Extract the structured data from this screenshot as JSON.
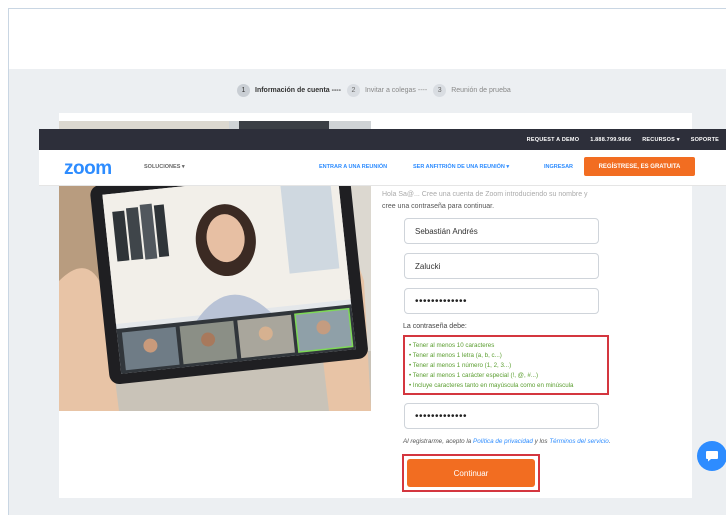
{
  "steps": [
    {
      "num": "1",
      "label": "Información de cuenta ----"
    },
    {
      "num": "2",
      "label": "Invitar a colegas ----"
    },
    {
      "num": "3",
      "label": "Reunión de prueba"
    }
  ],
  "topbar": {
    "request_demo": "REQUEST A DEMO",
    "phone": "1.888.799.9666",
    "resources": "RECURSOS ▾",
    "support": "SOPORTE"
  },
  "nav": {
    "logo": "zoom",
    "solutions": "SOLUCIONES ▾",
    "join": "ENTRAR A UNA REUNIÓN",
    "host": "SER ANFITRIÓN DE UNA REUNIÓN ▾",
    "signin": "INGRESAR",
    "signup": "REGÍSTRESE, ES GRATUITA"
  },
  "form": {
    "intro_line1": "Hola Sa@... Cree una cuenta de Zoom introduciendo su nombre y",
    "intro_line2": "cree una contraseña para continuar.",
    "first_name": "Sebastián Andrés",
    "last_name": "Zalucki",
    "password": "•••••••••••••",
    "rules_label": "La contraseña debe:",
    "rules": [
      "Tener al menos 10 caracteres",
      "Tener al menos 1 letra (a, b, c...)",
      "Tener al menos 1 número (1, 2, 3...)",
      "Tener al menos 1 carácter especial (!, @, #...)",
      "Incluye caracteres tanto en mayúscula como en minúscula"
    ],
    "confirm_password": "•••••••••••••",
    "terms_prefix": "Al registrarme, acepto la ",
    "privacy_link": "Política de privacidad",
    "terms_mid": " y los ",
    "terms_link": "Términos del servicio",
    "terms_suffix": ".",
    "continue": "Continuar"
  },
  "colors": {
    "accent_orange": "#f26d21",
    "zoom_blue": "#2d8cff",
    "highlight_red": "#d4363f",
    "rule_green": "#5a9e2f"
  }
}
